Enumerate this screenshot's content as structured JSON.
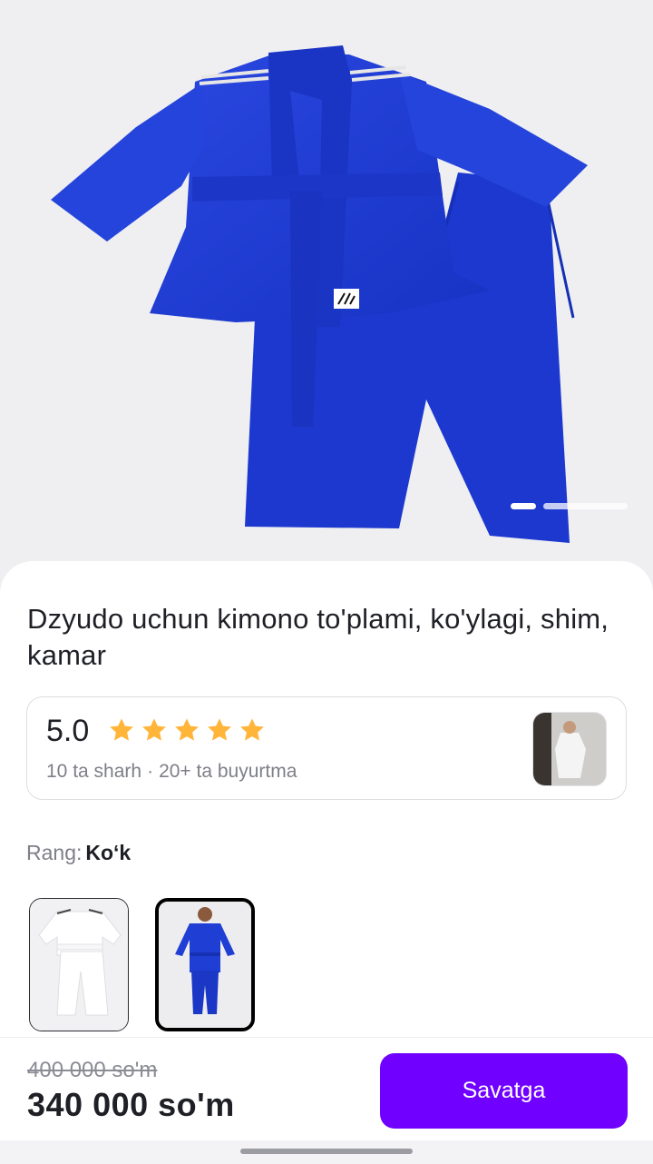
{
  "product": {
    "title": "Dzyudo uchun kimono to'plami, ko'ylagi, shim, kamar",
    "rating": {
      "score": "5.0",
      "stars": 5,
      "reviews": "10 ta sharh",
      "separator": "·",
      "orders": "20+ ta buyurtma"
    },
    "color": {
      "label": "Rang:",
      "value": "Ko‘k",
      "options": [
        "white",
        "blue"
      ],
      "selected": 1
    },
    "gallery": {
      "current_index": 1,
      "image_count": 2
    }
  },
  "price": {
    "old": "400 000 so'm",
    "current": "340 000 so'm"
  },
  "actions": {
    "cart_label": "Savatga"
  },
  "colors": {
    "accent": "#7000ff",
    "star": "#ffb43a",
    "kimono_blue": "#1b3fd6"
  }
}
